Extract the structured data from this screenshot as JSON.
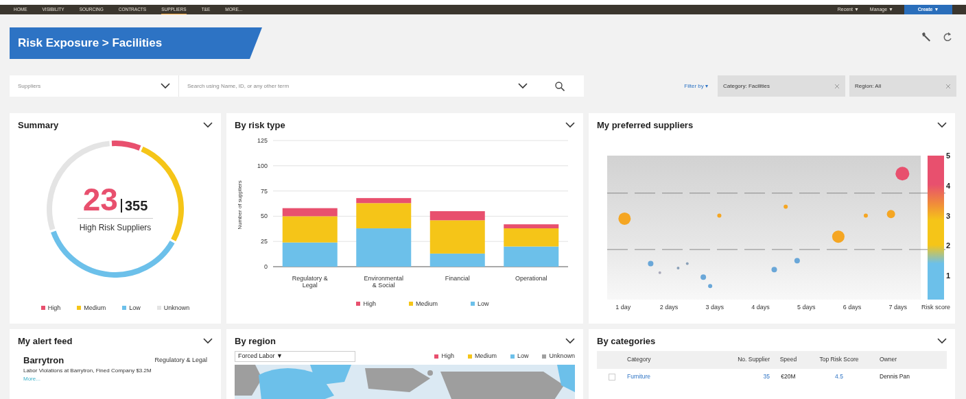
{
  "nav": {
    "items": [
      {
        "label": "HOME",
        "selected": false
      },
      {
        "label": "VISIBILITY",
        "selected": false
      },
      {
        "label": "SOURCING",
        "selected": false
      },
      {
        "label": "CONTRACTS",
        "selected": false
      },
      {
        "label": "SUPPLIERS",
        "selected": true
      },
      {
        "label": "T&E",
        "selected": false
      },
      {
        "label": "MORE...",
        "selected": false
      }
    ],
    "right": [
      "Recent ▼",
      "Manage ▼"
    ],
    "create": "Create ▼"
  },
  "header": {
    "breadcrumb": "Risk Exposure > Facilities"
  },
  "search": {
    "scope": "Suppliers",
    "placeholder": "Search using Name, ID, or any other term"
  },
  "filters": {
    "label": "Filter by ▾",
    "chips": [
      "Category: Facilities",
      "Region: All"
    ]
  },
  "summary": {
    "title": "Summary",
    "count": "23",
    "total": "355",
    "caption": "High Risk Suppliers",
    "legend": [
      {
        "label": "High",
        "color": "#e8506e"
      },
      {
        "label": "Medium",
        "color": "#f5c518"
      },
      {
        "label": "Low",
        "color": "#6cc0ea"
      },
      {
        "label": "Unknown",
        "color": "#e4e4e4"
      }
    ]
  },
  "risk_type": {
    "title": "By risk type",
    "chart_data": {
      "type": "bar",
      "stacked": true,
      "grid": true,
      "legend": true,
      "ylabel": "Number of suppliers",
      "categories": [
        "Regulatory & Legal",
        "Environmental & Social",
        "Financial",
        "Operational"
      ],
      "ylim": [
        0,
        125
      ],
      "yticks": [
        0,
        25,
        50,
        75,
        100,
        125
      ],
      "series": [
        {
          "name": "Low",
          "color": "#6cc0ea",
          "values": [
            24,
            38,
            13,
            20
          ]
        },
        {
          "name": "Medium",
          "color": "#f5c518",
          "values": [
            26,
            25,
            33,
            18
          ]
        },
        {
          "name": "High",
          "color": "#e8506e",
          "values": [
            8,
            5,
            9,
            4
          ]
        }
      ]
    }
  },
  "preferred": {
    "title": "My preferred suppliers",
    "x_labels": [
      "1 day",
      "2 days",
      "3 days",
      "4 days",
      "5 days",
      "6 days",
      "7 days"
    ],
    "scale_ticks": [
      "5",
      "4",
      "3",
      "2",
      "1"
    ],
    "scale_label": "Risk score"
  },
  "alerts": {
    "title": "My alert feed",
    "items": [
      {
        "name": "Barrytron",
        "category": "Regulatory & Legal",
        "text": "Labor Violations at Barrytron, Fined Company $3.2M",
        "link": "More..."
      }
    ]
  },
  "region": {
    "title": "By region",
    "dropdown": "Forced Labor ▼",
    "legend": [
      {
        "label": "High",
        "color": "#e8506e"
      },
      {
        "label": "Medium",
        "color": "#f5c518"
      },
      {
        "label": "Low",
        "color": "#6cc0ea"
      },
      {
        "label": "Unknown",
        "color": "#a0a0a0"
      }
    ]
  },
  "categories": {
    "title": "By categories",
    "columns": [
      "Category",
      "No. Supplier",
      "Speed",
      "Top Risk Score",
      "Owner"
    ],
    "rows": [
      {
        "checked": false,
        "cells": [
          "Furniture",
          "35",
          "€20M",
          "4.5",
          "Dennis Pan"
        ]
      }
    ]
  }
}
